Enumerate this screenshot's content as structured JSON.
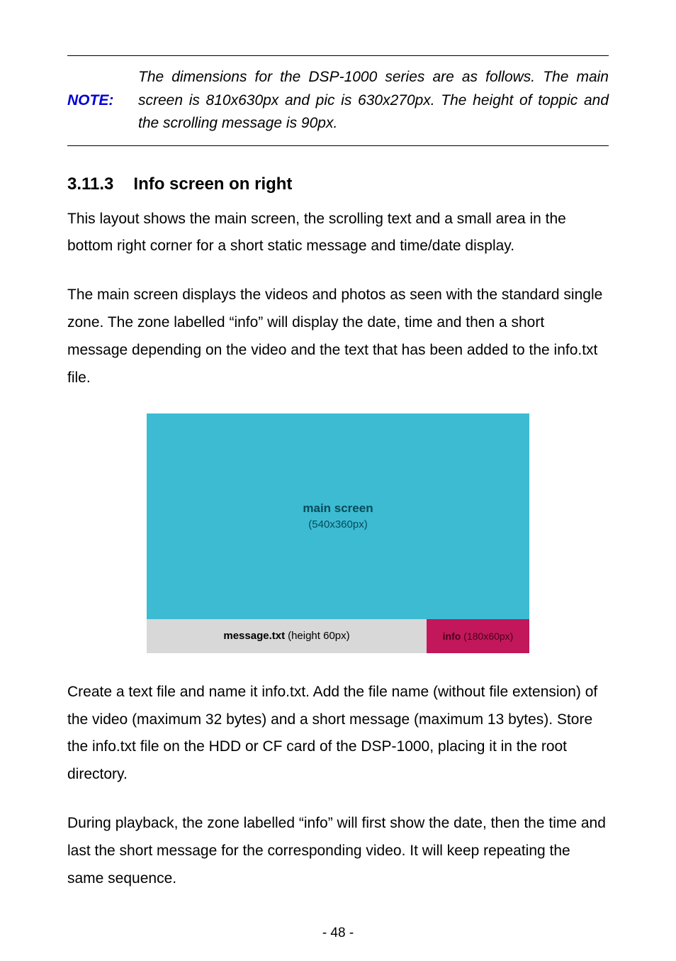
{
  "note": {
    "label": "NOTE:",
    "text": "The dimensions for the DSP-1000 series are as follows. The main screen is 810x630px and pic is 630x270px. The height of toppic and the scrolling message is 90px."
  },
  "section": {
    "number": "3.11.3",
    "title": "Info screen on right"
  },
  "para1": "This layout shows the main screen, the scrolling text and a small area in the bottom right corner for a short static message and time/date display.",
  "para2": "The main screen displays the videos and photos as seen with the standard single zone. The zone labelled “info” will display the date, time and then a short message depending on the video and the text that has been added to the info.txt file.",
  "diagram": {
    "main_title": "main screen",
    "main_dim": "(540x360px)",
    "msg_label": "message.txt",
    "msg_dim": "(height 60px)",
    "info_label": "info",
    "info_dim": "(180x60px)"
  },
  "para3": "Create a text file and name it info.txt. Add the file name (without file extension) of the video (maximum 32 bytes) and a short message (maximum 13 bytes). Store the info.txt file on the HDD or CF card of the DSP-1000, placing it in the root directory.",
  "para4": "During playback, the zone labelled “info” will first show the date, then the time and last the short message for the corresponding video. It will keep repeating the same sequence.",
  "page_number": "- 48 -"
}
